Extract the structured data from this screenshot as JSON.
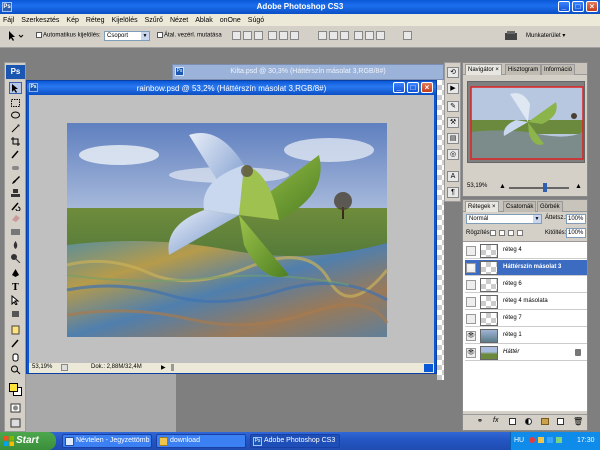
{
  "window": {
    "title": "Adobe Photoshop CS3",
    "app_icon": "Ps"
  },
  "menu": [
    "Fájl",
    "Szerkesztés",
    "Kép",
    "Réteg",
    "Kijelölés",
    "Szűrő",
    "Nézet",
    "Ablak",
    "onOne",
    "Súgó"
  ],
  "options_bar": {
    "auto_select_label": "Automatikus kijelölés:",
    "auto_select_value": "Csoport",
    "transform_controls_label": "Átal. vezérl. mutatása",
    "workspace_label": "Munkaterület ▾"
  },
  "tools": {
    "logo": "Ps",
    "icons": [
      "move-icon",
      "marquee-icon",
      "lasso-icon",
      "magic-wand-icon",
      "crop-icon",
      "eyedropper-icon",
      "healing-icon",
      "brush-icon",
      "stamp-icon",
      "history-brush-icon",
      "eraser-icon",
      "gradient-icon",
      "blur-icon",
      "dodge-icon",
      "pen-icon",
      "type-icon",
      "path-select-icon",
      "shape-icon",
      "notes-icon",
      "eyedropper2-icon",
      "hand-icon",
      "zoom-icon"
    ]
  },
  "background_document": {
    "title": "Kilta.psd @ 30,3% (Háttérszín másolat 3,RGB/8#)"
  },
  "document": {
    "title": "rainbow.psd @ 53,2% (Háttérszín másolat 3,RGB/8#)",
    "zoom": "53,19%",
    "doc_info": "Dok.: 2,88M/32,4M"
  },
  "navigator": {
    "tabs": [
      "Navigátor",
      "Hisztogram",
      "Információ"
    ],
    "zoom": "53,19%"
  },
  "layers": {
    "tabs": [
      "Rétegek",
      "Csatornák",
      "Görbék"
    ],
    "blend_mode": "Normál",
    "opacity_label": "Áttetsz.:",
    "opacity_value": "100%",
    "lock_label": "Rögzítés:",
    "fill_label": "Kitöltés:",
    "fill_value": "100%",
    "items": [
      {
        "name": "réteg 4",
        "visible": false,
        "selected": false
      },
      {
        "name": "Háttérszín másolat 3",
        "visible": true,
        "selected": true
      },
      {
        "name": "réteg 6",
        "visible": false,
        "selected": false
      },
      {
        "name": "réteg 4 másolata",
        "visible": false,
        "selected": false
      },
      {
        "name": "réteg 7",
        "visible": false,
        "selected": false
      },
      {
        "name": "réteg 1",
        "visible": true,
        "selected": false
      },
      {
        "name": "Háttér",
        "visible": true,
        "selected": false
      }
    ]
  },
  "taskbar": {
    "start_label": "Start",
    "tasks": [
      "Névtelen - Jegyzettömb",
      "download",
      "Adobe Photoshop CS3"
    ],
    "lang": "HU",
    "clock": "17:30"
  },
  "colors": {
    "titlebar_blue": "#0a58d6",
    "selected_layer": "#3c6bc2",
    "panel_gray": "#d4d0c8"
  }
}
